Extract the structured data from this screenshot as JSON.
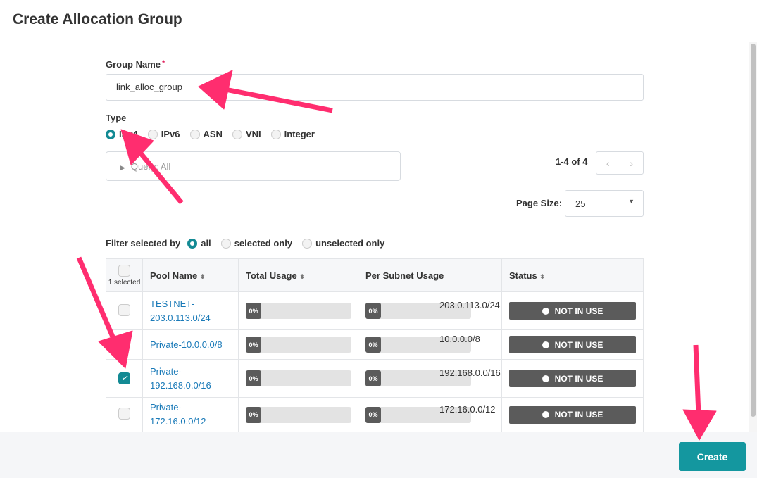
{
  "dialog": {
    "title": "Create Allocation Group"
  },
  "form": {
    "group_name_label": "Group Name",
    "required_mark": "*",
    "group_name_value": "link_alloc_group",
    "type_label": "Type",
    "types": [
      "IPv4",
      "IPv6",
      "ASN",
      "VNI",
      "Integer"
    ],
    "selected_type": "IPv4",
    "query": "Query: All"
  },
  "pagination": {
    "range": "1-4 of 4",
    "prev": "‹",
    "next": "›",
    "page_size_label": "Page Size:",
    "page_size": "25"
  },
  "filter": {
    "label": "Filter selected by",
    "options": [
      "all",
      "selected only",
      "unselected only"
    ],
    "selected": "all"
  },
  "table": {
    "selected_count": "1 selected",
    "columns": [
      "Pool Name",
      "Total Usage",
      "Per Subnet Usage",
      "Status"
    ],
    "rows": [
      {
        "name": "TESTNET-203.0.113.0/24",
        "name_l1": "TESTNET-",
        "name_l2": "203.0.113.0/24",
        "total": "0%",
        "subnet_usage": "0%",
        "subnet": "203.0.113.0/24",
        "status": "NOT IN USE",
        "checked": false
      },
      {
        "name": "Private-10.0.0.0/8",
        "name_l1": "Private-10.0.0.0/8",
        "name_l2": "",
        "total": "0%",
        "subnet_usage": "0%",
        "subnet": "10.0.0.0/8",
        "status": "NOT IN USE",
        "checked": false
      },
      {
        "name": "Private-192.168.0.0/16",
        "name_l1": "Private-",
        "name_l2": "192.168.0.0/16",
        "total": "0%",
        "subnet_usage": "0%",
        "subnet": "192.168.0.0/16",
        "status": "NOT IN USE",
        "checked": true
      },
      {
        "name": "Private-172.16.0.0/12",
        "name_l1": "Private-",
        "name_l2": "172.16.0.0/12",
        "total": "0%",
        "subnet_usage": "0%",
        "subnet": "172.16.0.0/12",
        "status": "NOT IN USE",
        "checked": false
      }
    ]
  },
  "footer": {
    "create_label": "Create"
  },
  "colors": {
    "accent": "#14979f",
    "link": "#1a7ab8",
    "annotation_arrow": "#ff2d6f",
    "status_bg": "#5b5b5b"
  }
}
